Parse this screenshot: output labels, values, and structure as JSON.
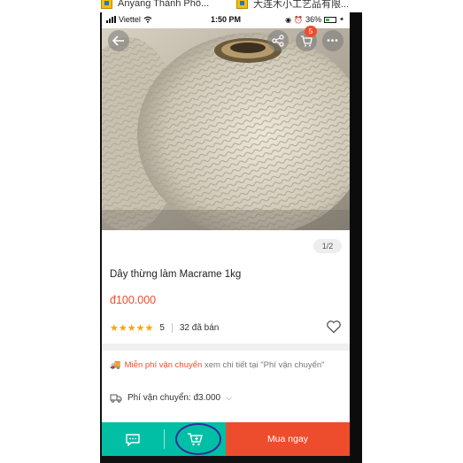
{
  "browser_tabs": [
    {
      "title": "Anyang Thành Phố..."
    },
    {
      "title": "大连木小工艺品有限..."
    }
  ],
  "status_bar": {
    "carrier": "Viettel",
    "time": "1:50 PM",
    "battery": "36%"
  },
  "header": {
    "back_icon": "arrow-left-icon",
    "share_icon": "share-icon",
    "cart_icon": "cart-icon",
    "cart_badge": "5",
    "more_icon": "more-dots-icon"
  },
  "product": {
    "image_counter": "1/2",
    "title": "Dây thừng làm Macrame 1kg",
    "price": "đ100.000",
    "rating_stars": "★★★★★",
    "rating_value": "5",
    "rating": 5,
    "sold": "32 đã bán"
  },
  "shipping": {
    "free_label": "Miễn phí vận chuyển",
    "free_detail": "xem chi tiết tại \"Phí vận chuyển\"",
    "fee_label": "Phí vận chuyển: đ3.000"
  },
  "bottom_bar": {
    "chat_icon": "chat-icon",
    "add_cart_icon": "add-to-cart-icon",
    "buy_label": "Mua ngay"
  },
  "colors": {
    "primary": "#ee4d2d",
    "teal": "#00bfa5",
    "star": "#f6a700",
    "annotation": "#3a2a9a"
  }
}
